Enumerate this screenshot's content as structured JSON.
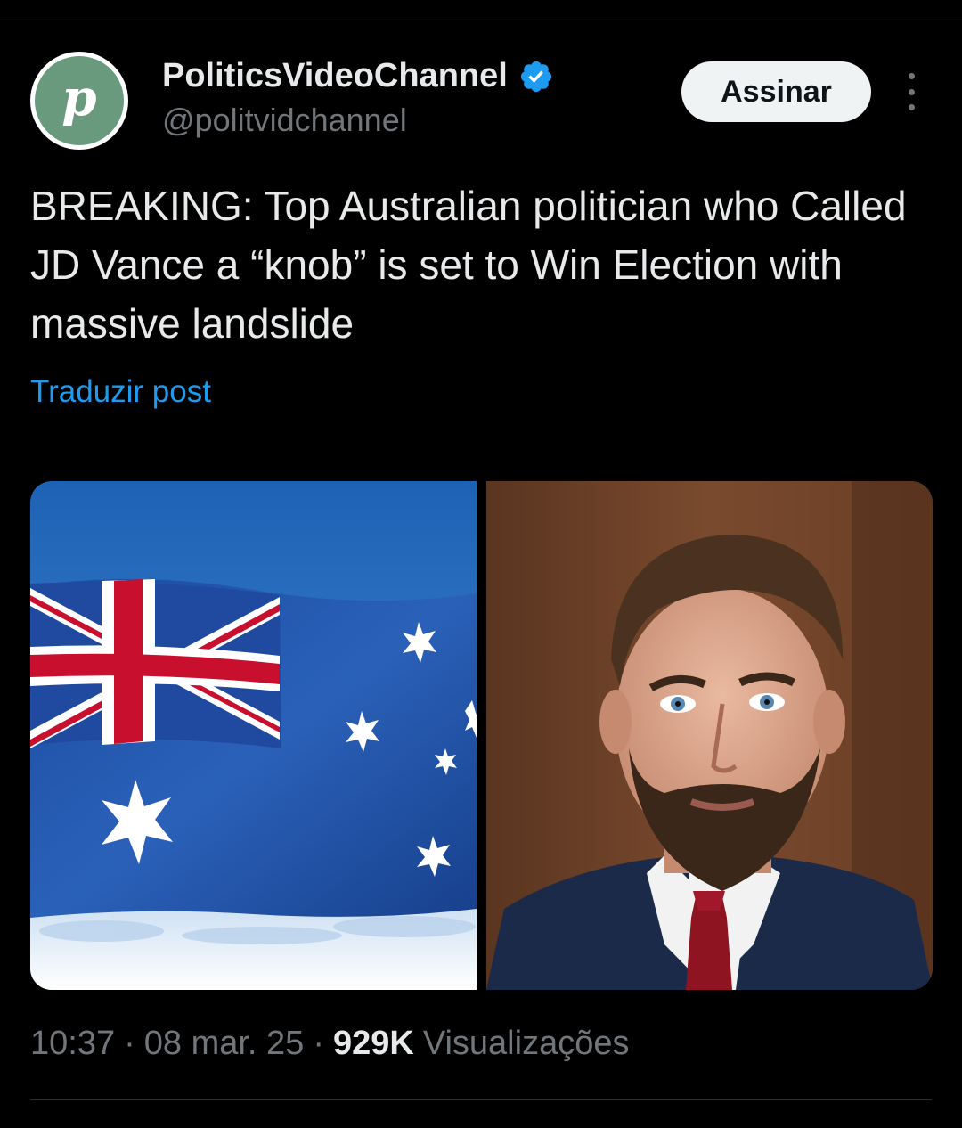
{
  "post": {
    "author": {
      "name": "PoliticsVideoChannel",
      "handle": "@politvidchannel",
      "verified": true,
      "avatar_letter": "p",
      "avatar_color": "#6a9a7e"
    },
    "subscribe_label": "Assinar",
    "text": "BREAKING: Top Australian politician who Called JD Vance a “knob” is set to Win Election with massive landslide",
    "translate_label": "Traduzir post",
    "media": [
      {
        "name": "australian-flag-image",
        "description_icon": "australian-flag"
      },
      {
        "name": "jd-vance-photo",
        "description_icon": "man-portrait"
      }
    ],
    "meta": {
      "time": "10:37",
      "date": "08 mar. 25",
      "views_count": "929K",
      "views_label": "Visualizações",
      "separator": "·"
    }
  },
  "colors": {
    "background": "#000000",
    "text": "#e7e9ea",
    "muted": "#71767b",
    "link": "#1d9bf0",
    "verified": "#1d9bf0",
    "button_bg": "#eff3f4"
  }
}
